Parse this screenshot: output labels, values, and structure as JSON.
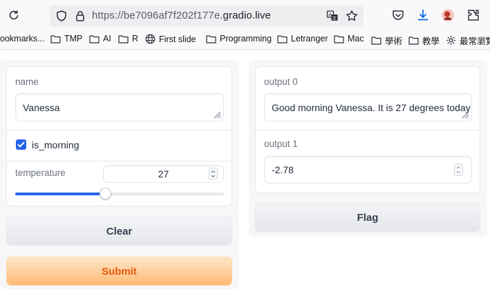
{
  "browser": {
    "url_prefix": "https://be7096af7f202f177e.",
    "url_host": "gradio.live",
    "bookmarks": [
      {
        "label": "ookmarks...",
        "icon": "none"
      },
      {
        "label": "TMP",
        "icon": "folder-icon"
      },
      {
        "label": "AI",
        "icon": "folder-icon"
      },
      {
        "label": "R",
        "icon": "folder-icon"
      },
      {
        "label": "First slide",
        "icon": "globe-icon"
      },
      {
        "label": "Programming",
        "icon": "folder-icon"
      },
      {
        "label": "Letranger",
        "icon": "folder-icon"
      },
      {
        "label": "Mac",
        "icon": "folder-icon"
      },
      {
        "label": "學術",
        "icon": "folder-icon"
      },
      {
        "label": "教學",
        "icon": "folder-icon"
      },
      {
        "label": "最常瀏覽",
        "icon": "gear-icon"
      }
    ]
  },
  "inputs": {
    "name": {
      "label": "name",
      "value": "Vanessa"
    },
    "is_morning": {
      "label": "is_morning",
      "checked": true
    },
    "temperature": {
      "label": "temperature",
      "value": "27",
      "slider_fraction": 0.43
    }
  },
  "outputs": {
    "output0": {
      "label": "output 0",
      "value": "Good morning Vanessa. It is 27 degrees today"
    },
    "output1": {
      "label": "output 1",
      "value": "-2.78"
    }
  },
  "buttons": {
    "clear": "Clear",
    "submit": "Submit",
    "flag": "Flag"
  },
  "colors": {
    "accent": "#2563eb",
    "submit_text": "#ea580c",
    "submit_bg": "#fdba74"
  }
}
